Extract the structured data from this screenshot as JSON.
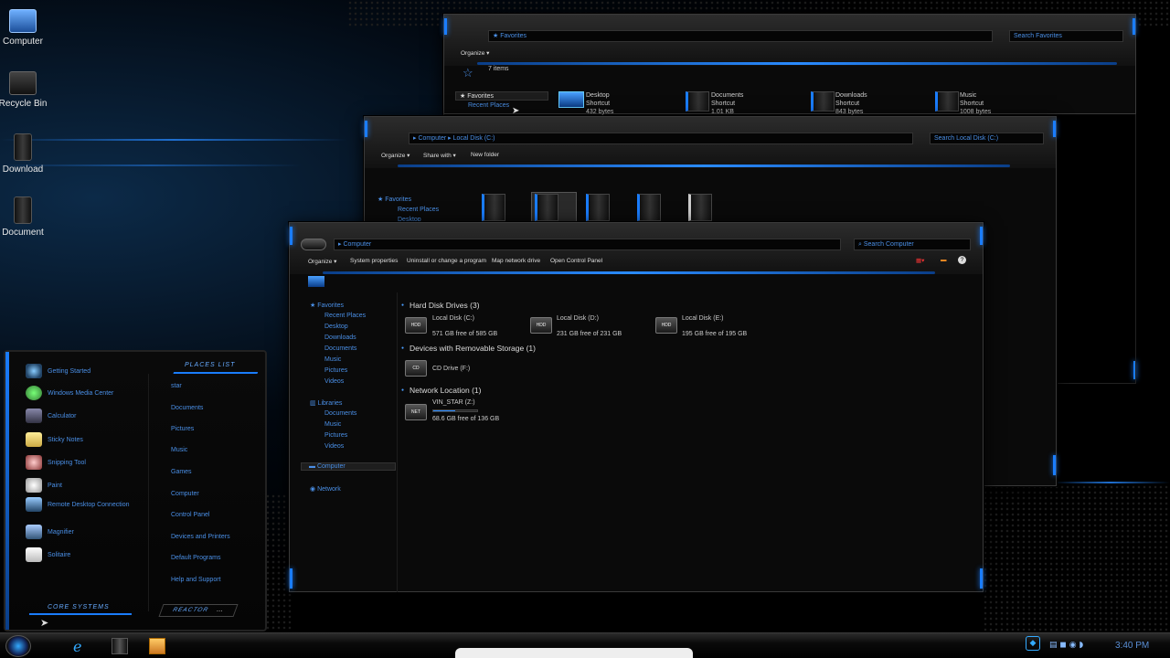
{
  "desktop_icons": [
    {
      "label": "Computer"
    },
    {
      "label": "Recycle Bin"
    },
    {
      "label": "Download"
    },
    {
      "label": "Document"
    }
  ],
  "win_favorites": {
    "breadcrumb": "Favorites",
    "search_placeholder": "Search Favorites",
    "organize": "Organize ▾",
    "count": "7 items",
    "nav": [
      "Favorites",
      "Recent Places"
    ],
    "items": [
      {
        "name": "Desktop",
        "type": "Shortcut",
        "size": "432 bytes"
      },
      {
        "name": "Documents",
        "type": "Shortcut",
        "size": "1.01 KB"
      },
      {
        "name": "Downloads",
        "type": "Shortcut",
        "size": "843 bytes"
      },
      {
        "name": "Music",
        "type": "Shortcut",
        "size": "1008 bytes"
      }
    ]
  },
  "win_localdisk": {
    "breadcrumb_1": "Computer",
    "breadcrumb_2": "Local Disk (C:)",
    "search_placeholder": "Search Local Disk (C:)",
    "toolbar": {
      "organize": "Organize ▾",
      "share": "Share with ▾",
      "new_folder": "New folder"
    },
    "nav": [
      "Favorites",
      "Recent Places",
      "Desktop"
    ]
  },
  "win_computer": {
    "breadcrumb": "Computer",
    "search_placeholder": "Search Computer",
    "toolbar": {
      "organize": "Organize ▾",
      "system_properties": "System properties",
      "uninstall": "Uninstall or change a program",
      "map_drive": "Map network drive",
      "control_panel": "Open Control Panel"
    },
    "nav": {
      "favorites": "Favorites",
      "recent": "Recent Places",
      "desktop": "Desktop",
      "downloads": "Downloads",
      "documents": "Documents",
      "music": "Music",
      "pictures": "Pictures",
      "videos": "Videos",
      "libraries": "Libraries",
      "lib_documents": "Documents",
      "lib_music": "Music",
      "lib_pictures": "Pictures",
      "lib_videos": "Videos",
      "computer": "Computer",
      "network": "Network"
    },
    "sections": {
      "hdd": "Hard Disk Drives (3)",
      "removable": "Devices with Removable Storage (1)",
      "network": "Network Location (1)"
    },
    "drives": [
      {
        "name": "Local Disk (C:)",
        "free": "571 GB free of 585 GB",
        "used": 0.02
      },
      {
        "name": "Local Disk (D:)",
        "free": "231 GB free of 231 GB",
        "used": 0.0
      },
      {
        "name": "Local Disk (E:)",
        "free": "195 GB free of 195 GB",
        "used": 0.0
      }
    ],
    "cd": {
      "name": "CD Drive (F:)"
    },
    "netdrive": {
      "name": "VIN_STAR (Z:)",
      "free": "68.6 GB free of 136 GB",
      "used": 0.5
    }
  },
  "start_menu": {
    "programs": [
      "Getting Started",
      "Windows Media Center",
      "Calculator",
      "Sticky Notes",
      "Snipping Tool",
      "Paint",
      "Remote Desktop Connection",
      "Magnifier",
      "Solitaire"
    ],
    "places_header": "PLACES LIST",
    "places": [
      "star",
      "Documents",
      "Pictures",
      "Music",
      "Games",
      "Computer",
      "Control Panel",
      "Devices and Printers",
      "Default Programs",
      "Help and Support"
    ],
    "core_systems": "CORE SYSTEMS",
    "reactor": "REACTOR",
    "reactor_arrow": "..."
  },
  "taskbar": {
    "time": "3:40 PM"
  },
  "colors": {
    "accent": "#1a7dff",
    "link": "#4a8fe6"
  }
}
